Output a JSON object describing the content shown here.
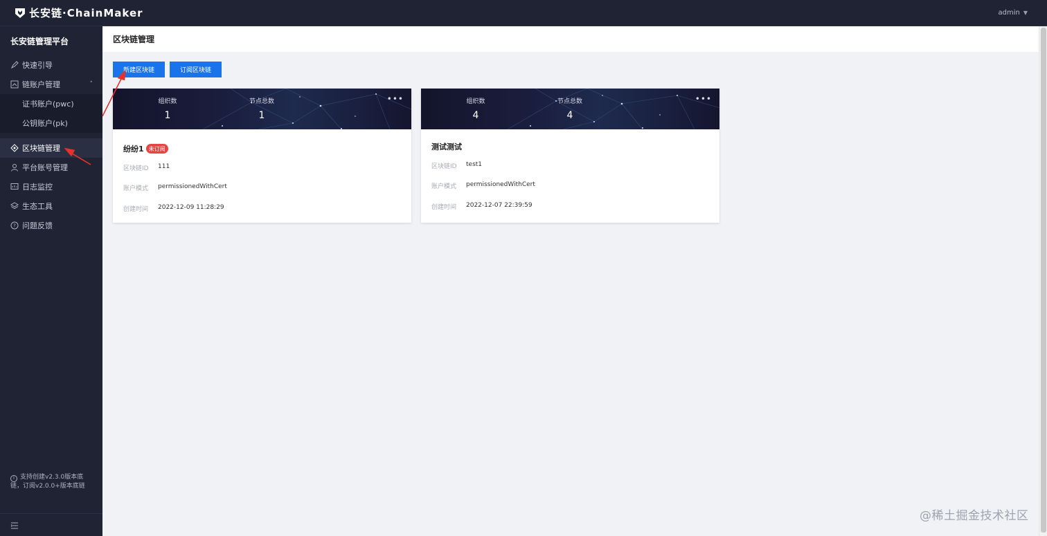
{
  "topbar": {
    "logo_text": "长安链·ChainMaker",
    "user": "admin"
  },
  "sidebar": {
    "title": "长安链管理平台",
    "items": [
      {
        "label": "快速引导",
        "icon": "rocket-icon"
      },
      {
        "label": "链账户管理",
        "icon": "account-icon",
        "expanded": true,
        "children": [
          {
            "label": "证书账户(pwc)"
          },
          {
            "label": "公钥账户(pk)"
          }
        ]
      },
      {
        "label": "区块链管理",
        "icon": "blockchain-icon",
        "active": true
      },
      {
        "label": "平台账号管理",
        "icon": "user-icon"
      },
      {
        "label": "日志监控",
        "icon": "monitor-icon"
      },
      {
        "label": "生态工具",
        "icon": "layers-icon"
      },
      {
        "label": "问题反馈",
        "icon": "question-icon"
      }
    ],
    "note": "支持创建v2.3.0版本底链，订阅v2.0.0+版本底链"
  },
  "main": {
    "title": "区块链管理",
    "buttons": {
      "new_chain": "新建区块链",
      "subscribe_chain": "订阅区块链"
    },
    "cards": [
      {
        "org_label": "组织数",
        "org_count": "1",
        "node_label": "节点总数",
        "node_count": "1",
        "name": "纷纷1",
        "badge": "未订阅",
        "chain_id_label": "区块链ID",
        "chain_id": "111",
        "mode_label": "账户模式",
        "mode": "permissionedWithCert",
        "created_label": "创建时间",
        "created": "2022-12-09 11:28:29"
      },
      {
        "org_label": "组织数",
        "org_count": "4",
        "node_label": "节点总数",
        "node_count": "4",
        "name": "测试测试",
        "chain_id_label": "区块链ID",
        "chain_id": "test1",
        "mode_label": "账户模式",
        "mode": "permissionedWithCert",
        "created_label": "创建时间",
        "created": "2022-12-07 22:39:59"
      }
    ]
  },
  "watermark": "@稀土掘金技术社区",
  "colors": {
    "sidebar_bg": "#1f2334",
    "primary_button": "#1a73e8",
    "badge_red": "#e64545",
    "annotation_arrow": "#e5322d"
  }
}
